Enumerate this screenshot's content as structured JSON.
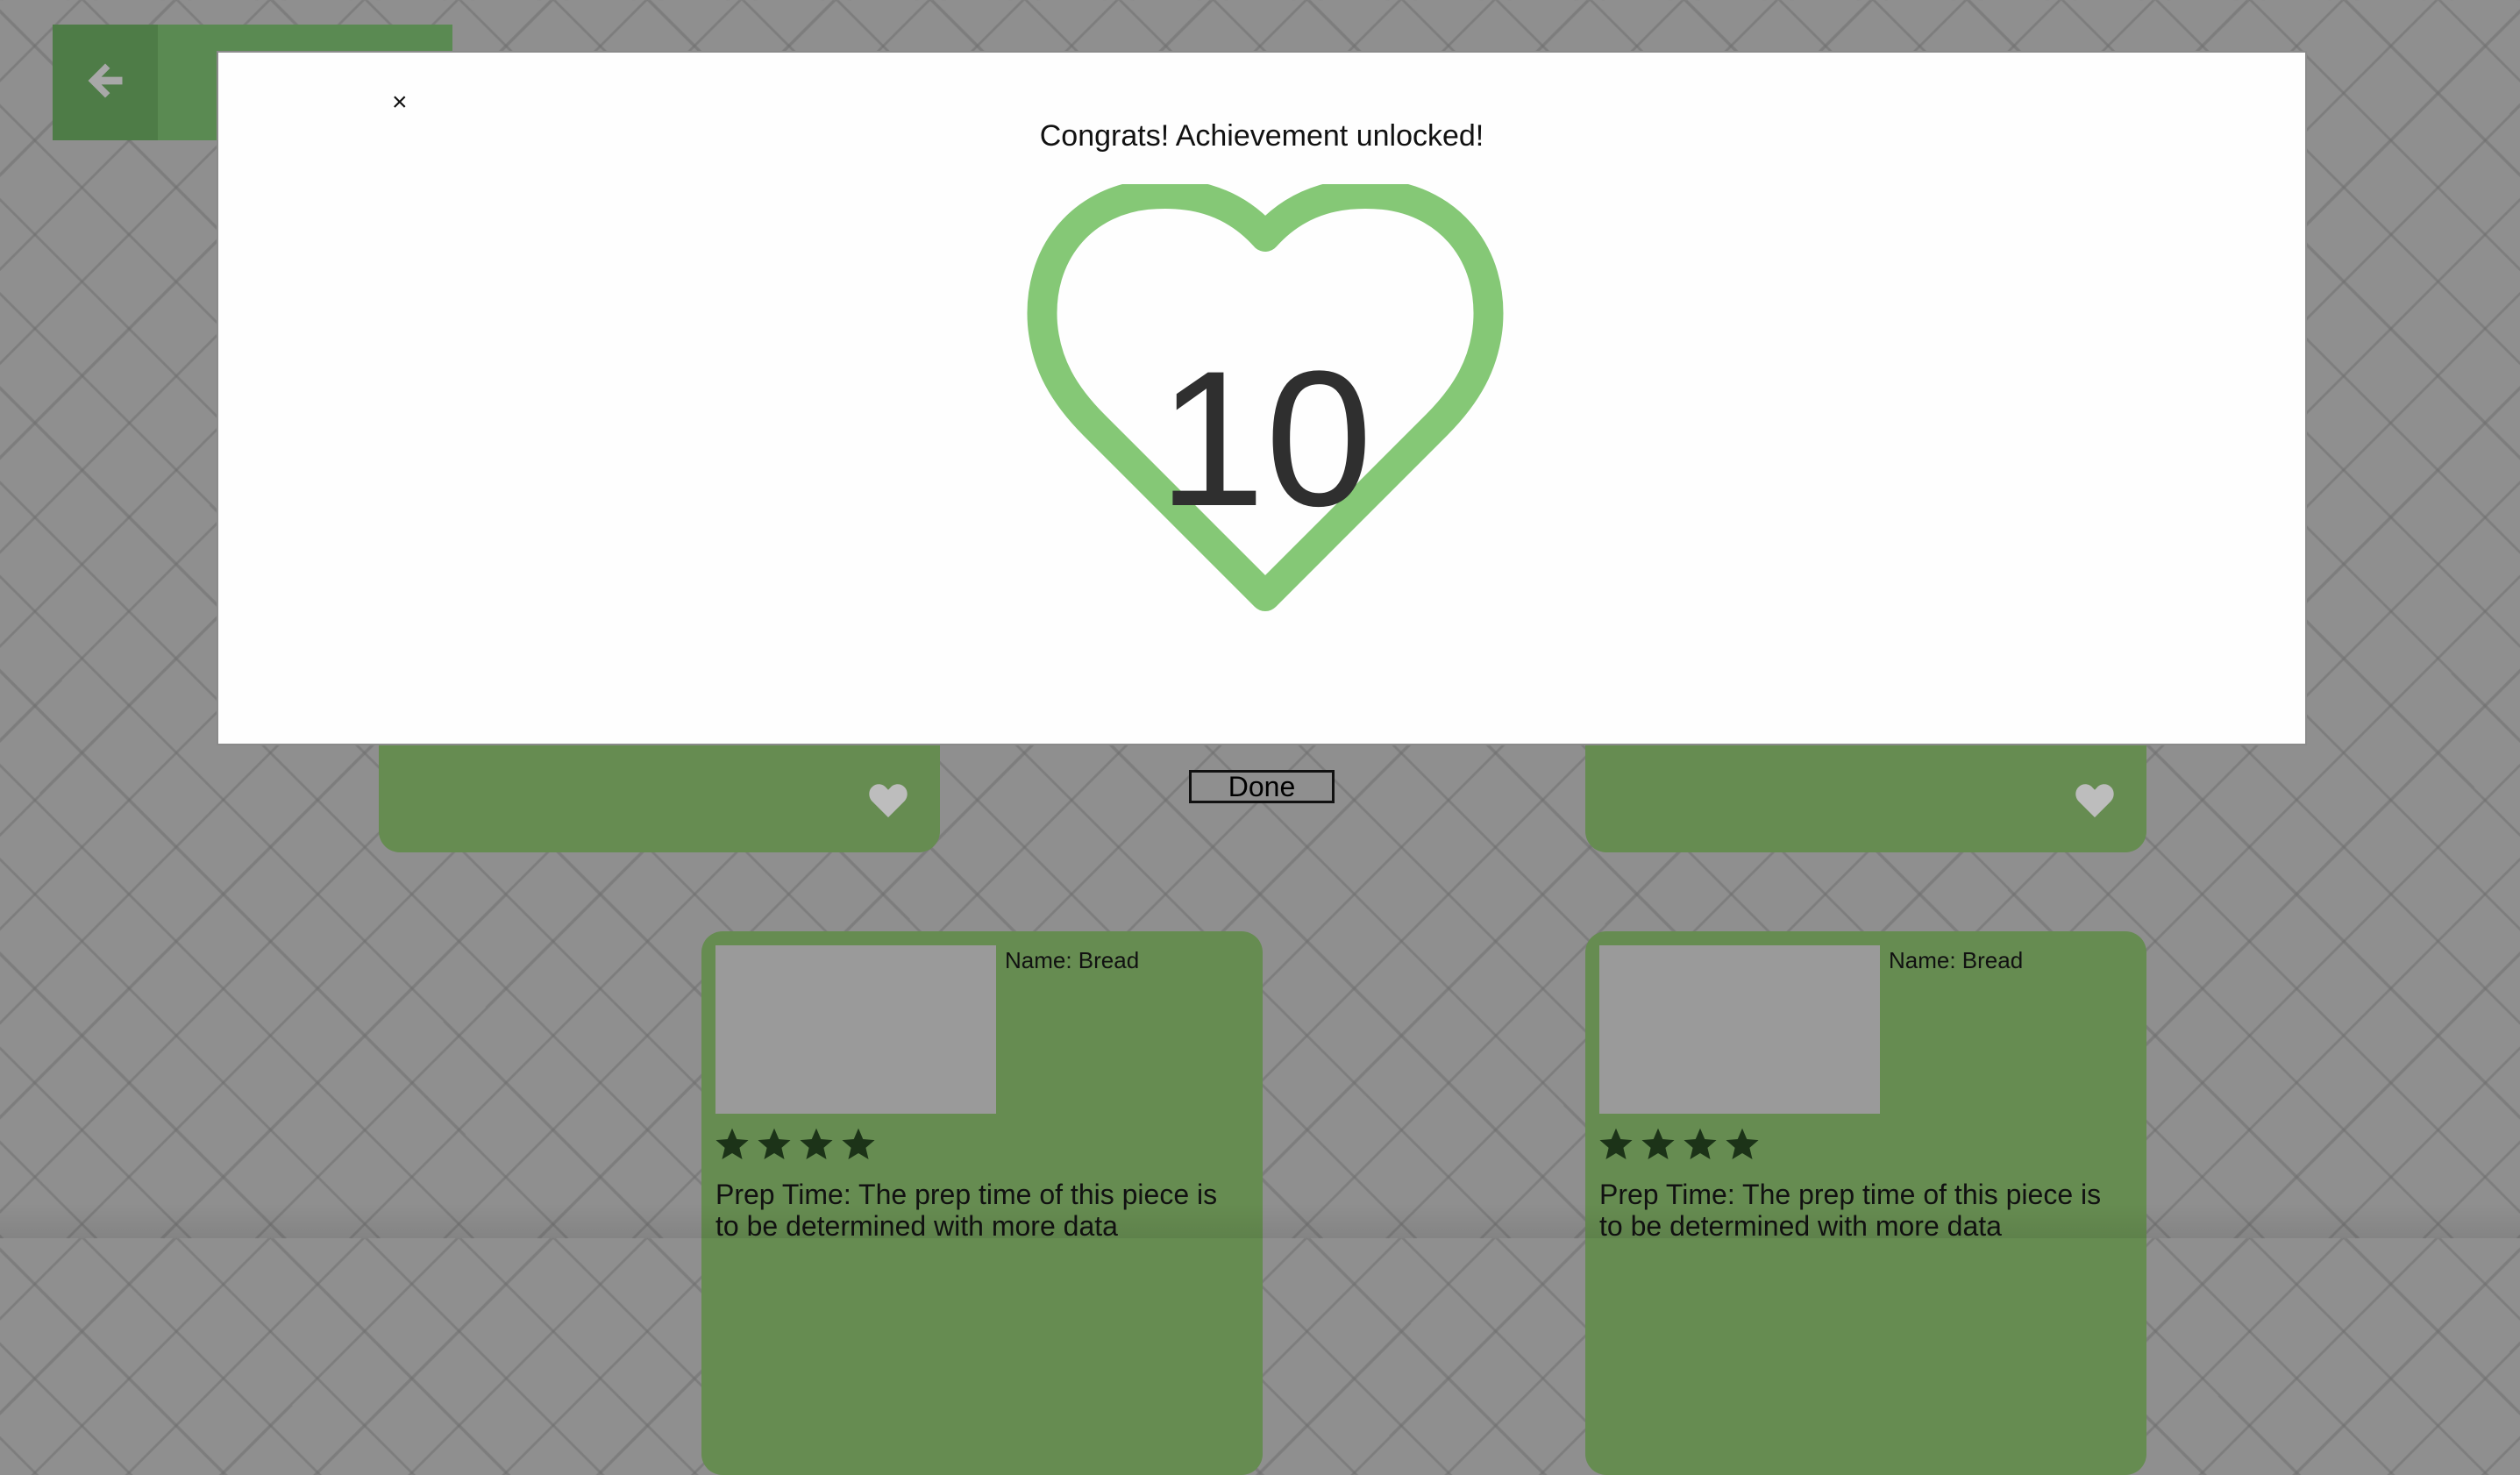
{
  "colors": {
    "card_green": "#668c51",
    "heart_green": "#85c876",
    "star_dark": "#1c3318",
    "background_gray": "#8f8f8f"
  },
  "header": {
    "back_icon": "arrow-left-icon"
  },
  "modal": {
    "close_label": "×",
    "title": "Congrats! Achievement unlocked!",
    "badge_icon": "heart-outline-icon",
    "badge_number": "10"
  },
  "done_label": "Done",
  "favorites": {
    "icon": "heart-icon"
  },
  "recipes": [
    {
      "name": "Name: Bread",
      "rating": 4,
      "prep_time": "Prep Time: The prep time of this piece is to be determined with more data"
    },
    {
      "name": "Name: Bread",
      "rating": 4,
      "prep_time": "Prep Time: The prep time of this piece is to be determined with more data"
    }
  ]
}
